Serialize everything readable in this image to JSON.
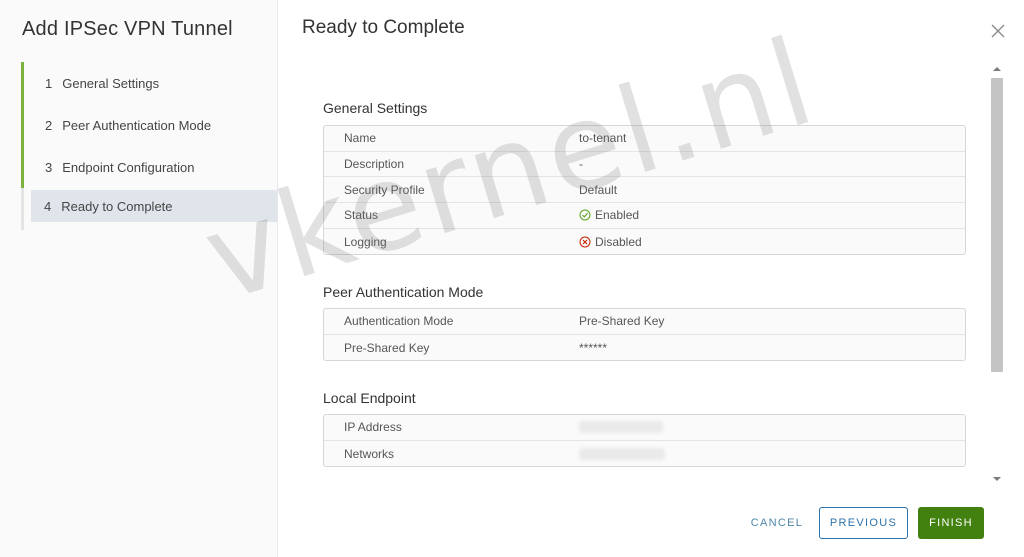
{
  "wizard": {
    "title": "Add IPSec VPN Tunnel",
    "steps": [
      {
        "num": "1",
        "label": "General Settings"
      },
      {
        "num": "2",
        "label": "Peer Authentication Mode"
      },
      {
        "num": "3",
        "label": "Endpoint Configuration"
      },
      {
        "num": "4",
        "label": "Ready to Complete"
      }
    ]
  },
  "main": {
    "title": "Ready to Complete",
    "sections": {
      "general": {
        "title": "General Settings",
        "rows": [
          {
            "key": "Name",
            "value": "to-tenant"
          },
          {
            "key": "Description",
            "value": "-"
          },
          {
            "key": "Security Profile",
            "value": "Default"
          },
          {
            "key": "Status",
            "value": "Enabled"
          },
          {
            "key": "Logging",
            "value": "Disabled"
          }
        ]
      },
      "peer_auth": {
        "title": "Peer Authentication Mode",
        "rows": [
          {
            "key": "Authentication Mode",
            "value": "Pre-Shared Key"
          },
          {
            "key": "Pre-Shared Key",
            "value": "******"
          }
        ]
      },
      "local_endpoint": {
        "title": "Local Endpoint",
        "rows": [
          {
            "key": "IP Address",
            "value": ""
          },
          {
            "key": "Networks",
            "value": ""
          }
        ]
      }
    }
  },
  "footer": {
    "cancel_label": "CANCEL",
    "previous_label": "PREVIOUS",
    "finish_label": "FINISH"
  },
  "watermark": "vkernel.nl",
  "colors": {
    "completed_step_accent": "#7bb13d",
    "current_step_bg": "#dfe5eb",
    "primary_button": "#42800f",
    "secondary_button": "#2d72a8",
    "enabled_icon": "#5aa220",
    "disabled_icon": "#c92100"
  }
}
